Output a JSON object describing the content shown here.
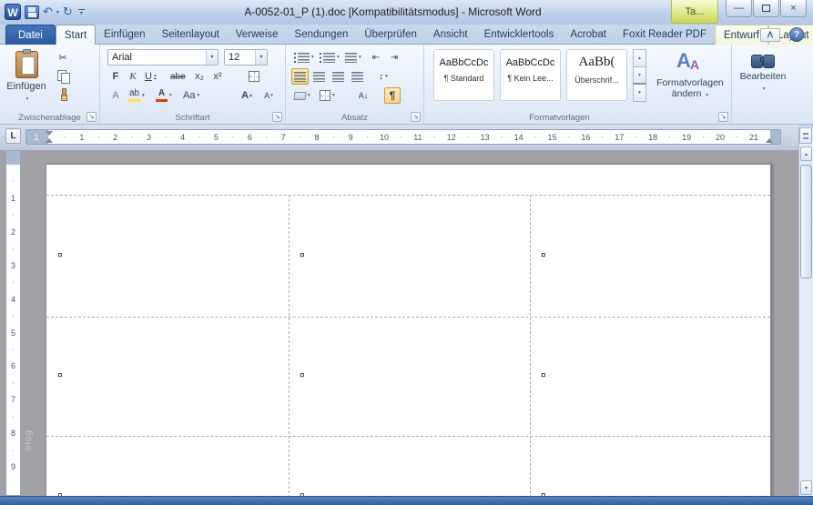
{
  "window": {
    "title": "A-0052-01_P (1).doc [Kompatibilitätsmodus]  -  Microsoft Word",
    "contextual_group_label": "Ta..."
  },
  "icons": {
    "dropdown": "▼",
    "dropdown_sm": "▾",
    "up_sm": "▴",
    "word_logo": "W",
    "undo": "↶",
    "redo": "↻",
    "minimize": "—",
    "close": "×",
    "help": "?",
    "collapse_ribbon": "ᐱ",
    "launcher": "↘",
    "scissors": "✂",
    "paragraph_mark": "¶",
    "updown": "↕",
    "sort": "A↓",
    "indent_left": "⇤",
    "indent_right": "⇥"
  },
  "tabs": [
    {
      "label": "Datei"
    },
    {
      "label": "Start"
    },
    {
      "label": "Einfügen"
    },
    {
      "label": "Seitenlayout"
    },
    {
      "label": "Verweise"
    },
    {
      "label": "Sendungen"
    },
    {
      "label": "Überprüfen"
    },
    {
      "label": "Ansicht"
    },
    {
      "label": "Entwicklertools"
    },
    {
      "label": "Acrobat"
    },
    {
      "label": "Foxit Reader PDF"
    },
    {
      "label": "Entwurf"
    },
    {
      "label": "Layout"
    }
  ],
  "ribbon": {
    "clipboard": {
      "label": "Zwischenablage",
      "paste": "Einfügen"
    },
    "font": {
      "label": "Schriftart",
      "family": "Arial",
      "size": "12",
      "bold": "F",
      "italic": "K",
      "underline": "U",
      "strike": "abe",
      "subscript": "x₂",
      "superscript": "x²",
      "effects": "A",
      "highlight": "ab",
      "font_color": "A",
      "change_case": "Aa",
      "grow": "A",
      "shrink": "A"
    },
    "paragraph": {
      "label": "Absatz"
    },
    "styles": {
      "label": "Formatvorlagen",
      "gallery": [
        {
          "preview": "AaBbCcDc",
          "name": "¶ Standard"
        },
        {
          "preview": "AaBbCcDc",
          "name": "¶ Kein Lee..."
        },
        {
          "preview": "AaBb(",
          "name": "Überschrif..."
        }
      ],
      "change_label": "Formatvorlagen ändern"
    },
    "editing": {
      "label": "Bearbeiten"
    }
  },
  "ruler": {
    "h_margin_number": "1",
    "h_numbers": [
      "1",
      "2",
      "3",
      "4",
      "5",
      "6",
      "7",
      "8",
      "9",
      "10",
      "11",
      "12",
      "13",
      "14",
      "15",
      "16",
      "17",
      "18",
      "19",
      "20",
      "21"
    ],
    "v_numbers": [
      "1",
      "2",
      "3",
      "4",
      "5",
      "6",
      "7",
      "8",
      "9"
    ]
  },
  "document": {
    "cell_marker": "¤",
    "table_rows": 3,
    "table_cols": 3
  },
  "watermark": "blog",
  "colors": {
    "title_bar": "#bcd0ea",
    "file_tab": "#2c5a9e",
    "contextual_tab": "#c9d755",
    "active_toggle": "#f8d186",
    "status_bar": "#2d5f9f",
    "document_background": "#a2a2a6",
    "table_gridline": "#a0aec2"
  }
}
